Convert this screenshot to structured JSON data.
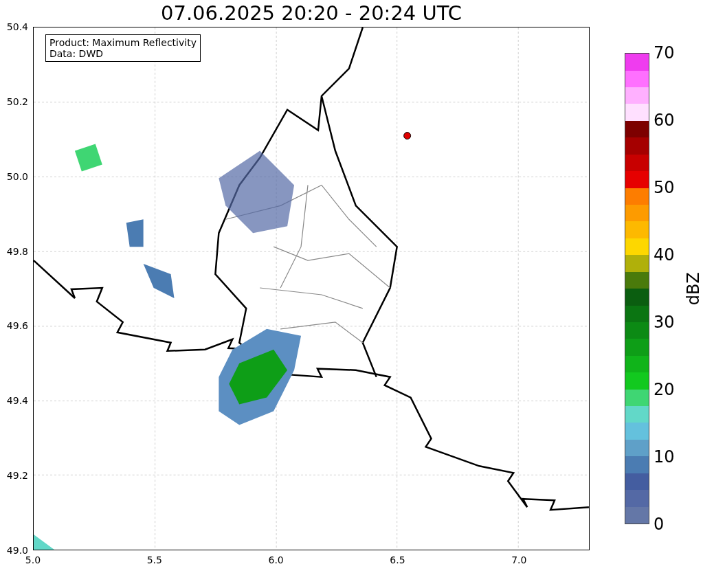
{
  "title": "07.06.2025 20:20 - 20:24 UTC",
  "info_box": [
    "Product: Maximum Reflectivity",
    "Data: DWD"
  ],
  "axes": {
    "xticks": [
      "5.0",
      "5.5",
      "6.0",
      "6.5",
      "7.0"
    ],
    "yticks": [
      "50.4",
      "50.2",
      "50.0",
      "49.8",
      "49.6",
      "49.4",
      "49.2",
      "49.0"
    ]
  },
  "colorbar": {
    "label": "dBZ",
    "ticks": [
      "70",
      "60",
      "50",
      "40",
      "30",
      "20",
      "10",
      "0"
    ],
    "segments": [
      {
        "color": "#6477a7"
      },
      {
        "color": "#5469a5"
      },
      {
        "color": "#445da0"
      },
      {
        "color": "#4b7cb2"
      },
      {
        "color": "#5fa0c8"
      },
      {
        "color": "#64c1dd"
      },
      {
        "color": "#62d8c8"
      },
      {
        "color": "#3fd673"
      },
      {
        "color": "#12c91f"
      },
      {
        "color": "#10b41a"
      },
      {
        "color": "#0e9e17"
      },
      {
        "color": "#0c8a14"
      },
      {
        "color": "#0b7512"
      },
      {
        "color": "#0b5e10"
      },
      {
        "color": "#4a7a0b"
      },
      {
        "color": "#b0b00a"
      },
      {
        "color": "#fdd700"
      },
      {
        "color": "#fdb900"
      },
      {
        "color": "#fd9b00"
      },
      {
        "color": "#fd7d00"
      },
      {
        "color": "#e60000"
      },
      {
        "color": "#c80000"
      },
      {
        "color": "#a50000"
      },
      {
        "color": "#7d0000"
      },
      {
        "color": "#ffe0ff"
      },
      {
        "color": "#ffb0ff"
      },
      {
        "color": "#ff70ff"
      },
      {
        "color": "#ef3cef"
      }
    ]
  }
}
